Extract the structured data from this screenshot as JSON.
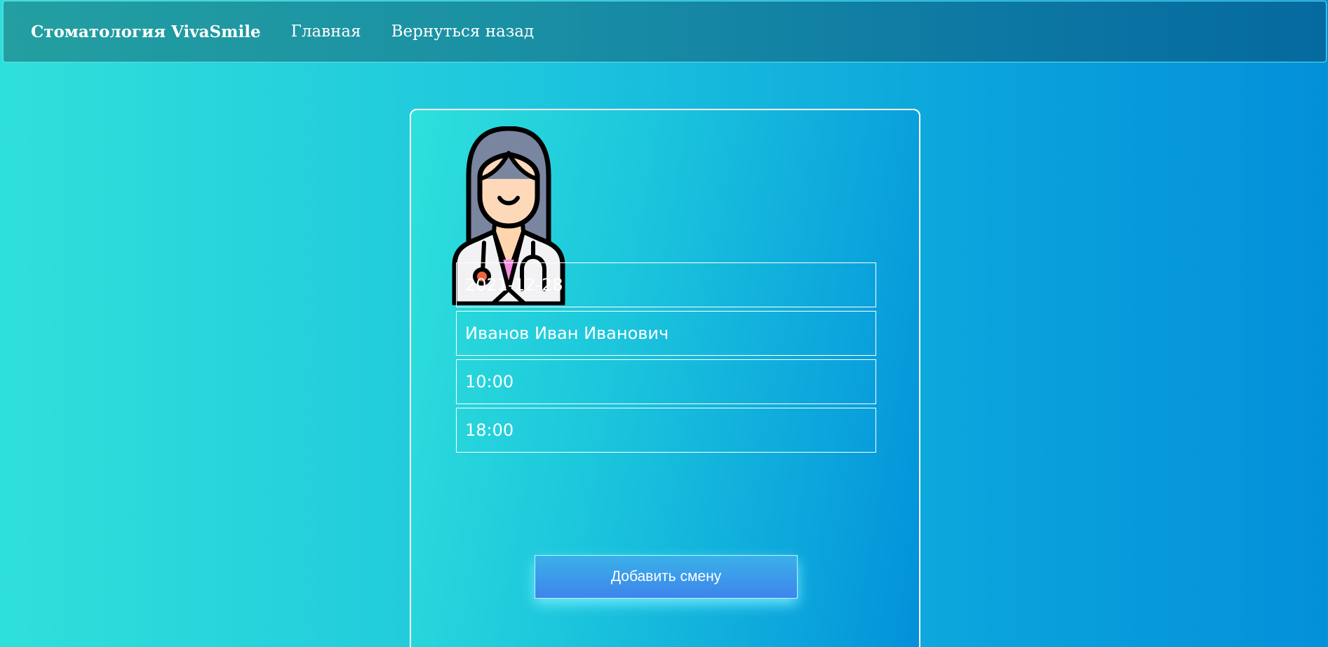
{
  "navbar": {
    "brand": "Стоматология VivaSmile",
    "links": [
      "Главная",
      "Вернуться назад"
    ]
  },
  "form": {
    "avatar_icon": "female-doctor-icon",
    "fields": {
      "date": "2021-12-28",
      "doctor": "Иванов Иван Иванович",
      "start_time": "10:00",
      "end_time": "18:00"
    },
    "submit_label": "Добавить смену"
  },
  "colors": {
    "background_start": "#2fe0da",
    "background_end": "#0390da",
    "navbar": "#1a8fa4",
    "button_top": "#3ab1e8",
    "button_bottom": "#3e84ec"
  }
}
